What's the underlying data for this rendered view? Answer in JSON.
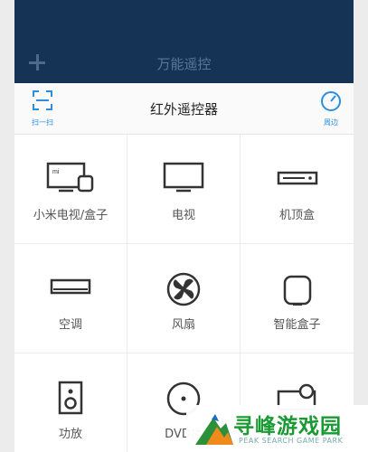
{
  "header": {
    "add_icon": "plus-icon",
    "title": "万能遥控"
  },
  "toolbar": {
    "scan_label": "扫一扫",
    "scan_icon": "scan-icon",
    "title": "红外遥控器",
    "nearby_label": "周边",
    "nearby_icon": "radar-icon"
  },
  "devices": [
    {
      "label": "小米电视/盒子",
      "icon": "mi-tv-box-icon"
    },
    {
      "label": "电视",
      "icon": "tv-icon"
    },
    {
      "label": "机顶盒",
      "icon": "set-top-box-icon"
    },
    {
      "label": "空调",
      "icon": "air-conditioner-icon"
    },
    {
      "label": "风扇",
      "icon": "fan-icon"
    },
    {
      "label": "智能盒子",
      "icon": "smart-box-icon"
    },
    {
      "label": "功放",
      "icon": "speaker-icon"
    },
    {
      "label": "DVD播",
      "icon": "dvd-icon"
    },
    {
      "label": "",
      "icon": "projector-icon"
    }
  ],
  "colors": {
    "header_bg": "#143355",
    "accent": "#2a8fe0",
    "icon": "#333333"
  },
  "watermark": {
    "title": "寻峰游戏园",
    "subtitle": "PEAK SEARCH GAME PARK"
  }
}
